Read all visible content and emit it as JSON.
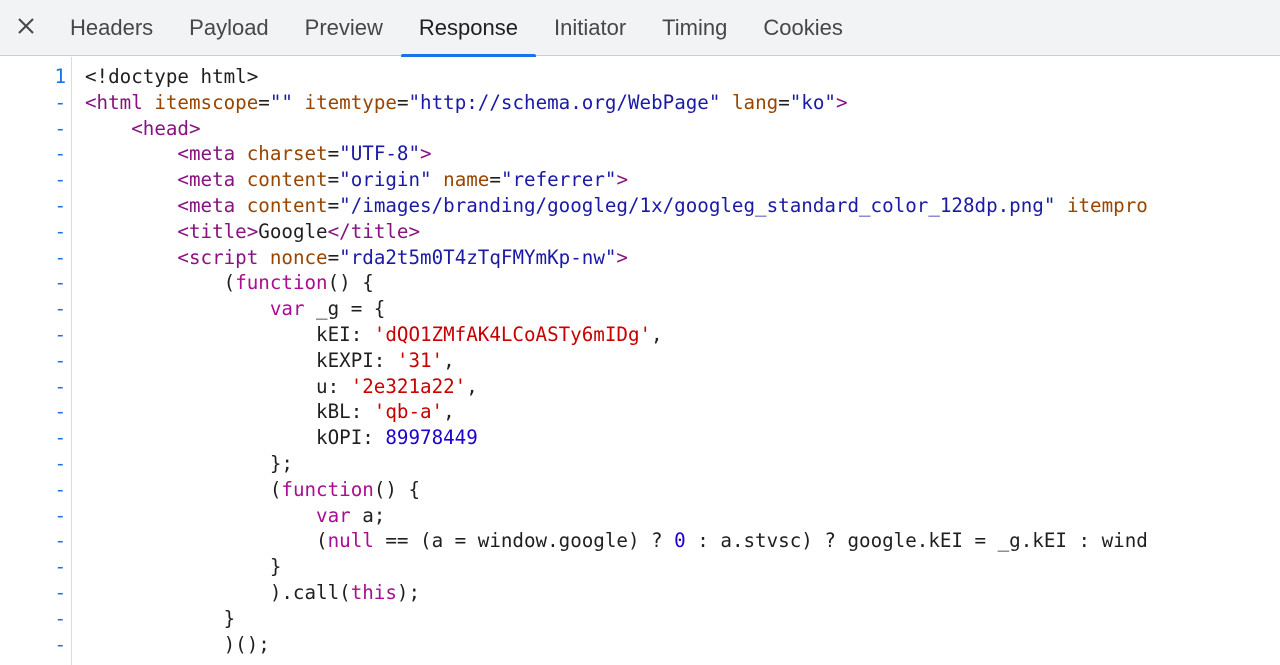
{
  "tabs": {
    "close_label": "×",
    "items": [
      {
        "id": "headers",
        "label": "Headers"
      },
      {
        "id": "payload",
        "label": "Payload"
      },
      {
        "id": "preview",
        "label": "Preview"
      },
      {
        "id": "response",
        "label": "Response",
        "active": true
      },
      {
        "id": "initiator",
        "label": "Initiator"
      },
      {
        "id": "timing",
        "label": "Timing"
      },
      {
        "id": "cookies",
        "label": "Cookies"
      }
    ]
  },
  "colors": {
    "accent": "#1a73e8",
    "tag": "#881280",
    "attribute": "#994500",
    "attribute_value": "#1a1aa6",
    "keyword": "#aa0d91",
    "string": "#c80000",
    "number": "#1c00cf"
  },
  "code": {
    "lines": [
      {
        "ln": "1",
        "segs": [
          [
            "plain",
            "<!doctype html>"
          ]
        ]
      },
      {
        "ln": "-",
        "segs": [
          [
            "tag",
            "<html "
          ],
          [
            "attr",
            "itemscope"
          ],
          [
            "plain",
            "="
          ],
          [
            "val",
            "\"\""
          ],
          [
            "plain",
            " "
          ],
          [
            "attr",
            "itemtype"
          ],
          [
            "plain",
            "="
          ],
          [
            "val",
            "\"http://schema.org/WebPage\""
          ],
          [
            "plain",
            " "
          ],
          [
            "attr",
            "lang"
          ],
          [
            "plain",
            "="
          ],
          [
            "val",
            "\"ko\""
          ],
          [
            "tag",
            ">"
          ]
        ]
      },
      {
        "ln": "-",
        "segs": [
          [
            "plain",
            "    "
          ],
          [
            "tag",
            "<head>"
          ]
        ]
      },
      {
        "ln": "-",
        "segs": [
          [
            "plain",
            "        "
          ],
          [
            "tag",
            "<meta "
          ],
          [
            "attr",
            "charset"
          ],
          [
            "plain",
            "="
          ],
          [
            "val",
            "\"UTF-8\""
          ],
          [
            "tag",
            ">"
          ]
        ]
      },
      {
        "ln": "-",
        "segs": [
          [
            "plain",
            "        "
          ],
          [
            "tag",
            "<meta "
          ],
          [
            "attr",
            "content"
          ],
          [
            "plain",
            "="
          ],
          [
            "val",
            "\"origin\""
          ],
          [
            "plain",
            " "
          ],
          [
            "attr",
            "name"
          ],
          [
            "plain",
            "="
          ],
          [
            "val",
            "\"referrer\""
          ],
          [
            "tag",
            ">"
          ]
        ]
      },
      {
        "ln": "-",
        "segs": [
          [
            "plain",
            "        "
          ],
          [
            "tag",
            "<meta "
          ],
          [
            "attr",
            "content"
          ],
          [
            "plain",
            "="
          ],
          [
            "val",
            "\"/images/branding/googleg/1x/googleg_standard_color_128dp.png\""
          ],
          [
            "plain",
            " "
          ],
          [
            "attr",
            "itempro"
          ]
        ]
      },
      {
        "ln": "-",
        "segs": [
          [
            "plain",
            "        "
          ],
          [
            "tag",
            "<title>"
          ],
          [
            "plain",
            "Google"
          ],
          [
            "tag",
            "</title>"
          ]
        ]
      },
      {
        "ln": "-",
        "segs": [
          [
            "plain",
            "        "
          ],
          [
            "tag",
            "<script "
          ],
          [
            "attr",
            "nonce"
          ],
          [
            "plain",
            "="
          ],
          [
            "val",
            "\"rda2t5m0T4zTqFMYmKp-nw\""
          ],
          [
            "tag",
            ">"
          ]
        ]
      },
      {
        "ln": "-",
        "segs": [
          [
            "plain",
            "            ("
          ],
          [
            "kw",
            "function"
          ],
          [
            "plain",
            "() {"
          ]
        ]
      },
      {
        "ln": "-",
        "segs": [
          [
            "plain",
            "                "
          ],
          [
            "kw",
            "var"
          ],
          [
            "plain",
            " _g = {"
          ]
        ]
      },
      {
        "ln": "-",
        "segs": [
          [
            "plain",
            "                    kEI: "
          ],
          [
            "str",
            "'dQO1ZMfAK4LCoASTy6mIDg'"
          ],
          [
            "plain",
            ","
          ]
        ]
      },
      {
        "ln": "-",
        "segs": [
          [
            "plain",
            "                    kEXPI: "
          ],
          [
            "str",
            "'31'"
          ],
          [
            "plain",
            ","
          ]
        ]
      },
      {
        "ln": "-",
        "segs": [
          [
            "plain",
            "                    u: "
          ],
          [
            "str",
            "'2e321a22'"
          ],
          [
            "plain",
            ","
          ]
        ]
      },
      {
        "ln": "-",
        "segs": [
          [
            "plain",
            "                    kBL: "
          ],
          [
            "str",
            "'qb-a'"
          ],
          [
            "plain",
            ","
          ]
        ]
      },
      {
        "ln": "-",
        "segs": [
          [
            "plain",
            "                    kOPI: "
          ],
          [
            "num",
            "89978449"
          ]
        ]
      },
      {
        "ln": "-",
        "segs": [
          [
            "plain",
            "                };"
          ]
        ]
      },
      {
        "ln": "-",
        "segs": [
          [
            "plain",
            "                ("
          ],
          [
            "kw",
            "function"
          ],
          [
            "plain",
            "() {"
          ]
        ]
      },
      {
        "ln": "-",
        "segs": [
          [
            "plain",
            "                    "
          ],
          [
            "kw",
            "var"
          ],
          [
            "plain",
            " a;"
          ]
        ]
      },
      {
        "ln": "-",
        "segs": [
          [
            "plain",
            "                    ("
          ],
          [
            "kw",
            "null"
          ],
          [
            "plain",
            " == (a = window.google) ? "
          ],
          [
            "num",
            "0"
          ],
          [
            "plain",
            " : a.stvsc) ? google.kEI = _g.kEI : wind"
          ]
        ]
      },
      {
        "ln": "-",
        "segs": [
          [
            "plain",
            "                }"
          ]
        ]
      },
      {
        "ln": "-",
        "segs": [
          [
            "plain",
            "                ).call("
          ],
          [
            "kw",
            "this"
          ],
          [
            "plain",
            ");"
          ]
        ]
      },
      {
        "ln": "-",
        "segs": [
          [
            "plain",
            "            }"
          ]
        ]
      },
      {
        "ln": "-",
        "segs": [
          [
            "plain",
            "            )();"
          ]
        ]
      }
    ]
  }
}
